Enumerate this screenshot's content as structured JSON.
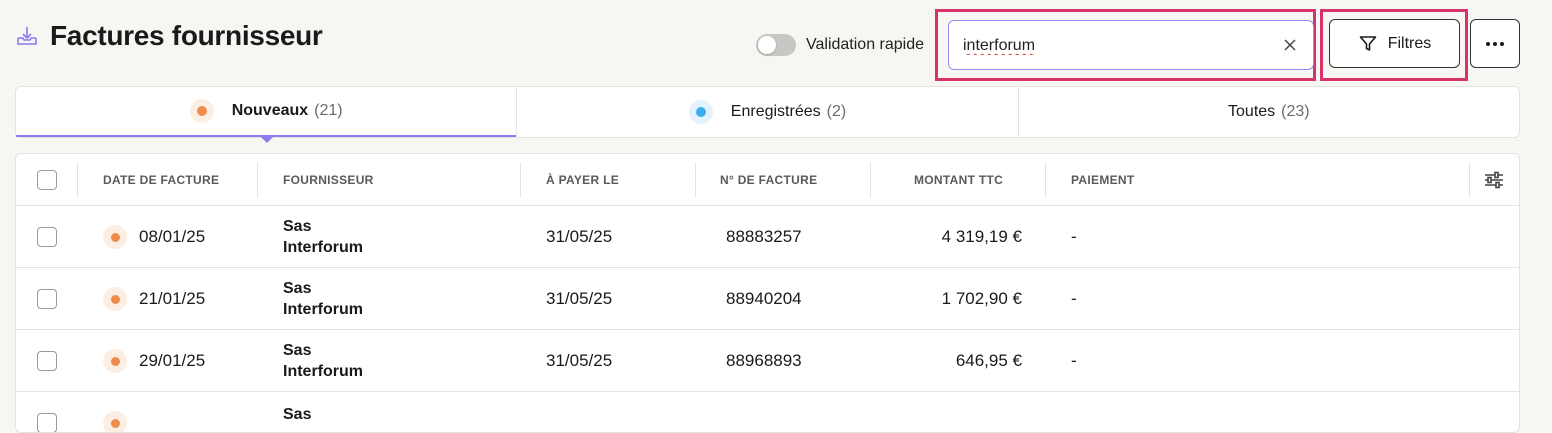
{
  "header": {
    "title": "Factures fournisseur",
    "toggle_label": "Validation rapide",
    "search_value": "interforum",
    "filter_label": "Filtres"
  },
  "colors": {
    "accent": "#8b7cf0",
    "highlight": "#d6336c",
    "status_new": "#ef8c4b",
    "status_saved": "#3aaef0"
  },
  "tabs": [
    {
      "label": "Nouveaux",
      "count": "(21)"
    },
    {
      "label": "Enregistrées",
      "count": "(2)"
    },
    {
      "label": "Toutes",
      "count": "(23)"
    }
  ],
  "table": {
    "columns": [
      "Date de facture",
      "Fournisseur",
      "À payer le",
      "N° de facture",
      "Montant TTC",
      "Paiement"
    ],
    "rows": [
      {
        "date": "08/01/25",
        "supplier_1": "Sas",
        "supplier_2": "Interforum",
        "due": "31/05/25",
        "number": "88883257",
        "amount": "4 319,19 €",
        "payment": "-"
      },
      {
        "date": "21/01/25",
        "supplier_1": "Sas",
        "supplier_2": "Interforum",
        "due": "31/05/25",
        "number": "88940204",
        "amount": "1 702,90 €",
        "payment": "-"
      },
      {
        "date": "29/01/25",
        "supplier_1": "Sas",
        "supplier_2": "Interforum",
        "due": "31/05/25",
        "number": "88968893",
        "amount": "646,95 €",
        "payment": "-"
      },
      {
        "date": "",
        "supplier_1": "Sas",
        "supplier_2": "",
        "due": "",
        "number": "",
        "amount": "",
        "payment": ""
      }
    ]
  }
}
